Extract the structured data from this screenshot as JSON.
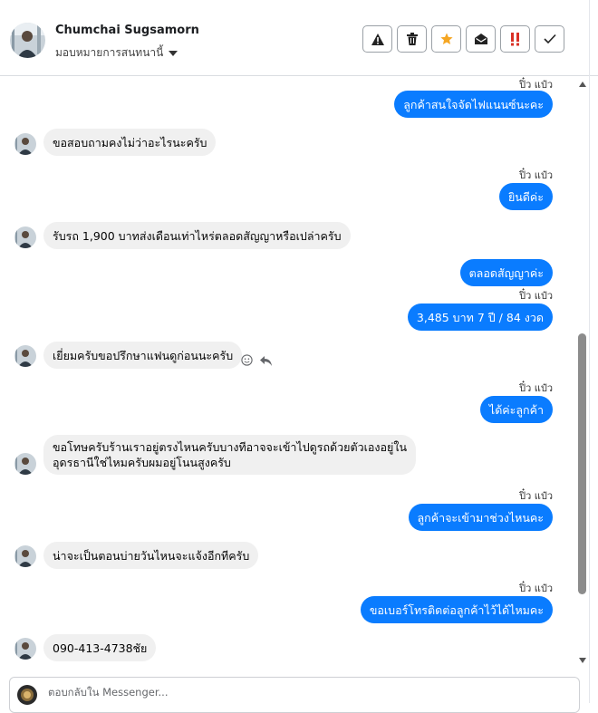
{
  "header": {
    "name": "Chumchai Sugsamorn",
    "assign_label": "มอบหมายการสนทนานี้",
    "actions": [
      {
        "name": "report-button",
        "icon": "warning-icon"
      },
      {
        "name": "delete-button",
        "icon": "trash-icon"
      },
      {
        "name": "star-button",
        "icon": "star-icon"
      },
      {
        "name": "mark-unread-button",
        "icon": "open-envelope-icon"
      },
      {
        "name": "spam-button",
        "icon": "spam-icon"
      },
      {
        "name": "done-button",
        "icon": "checkmark-icon"
      }
    ]
  },
  "messages": [
    {
      "dir": "out",
      "sender": "ปิ๋ว แป๋ว",
      "text": "ลูกค้าสนใจจัดไฟแนนซ์นะคะ"
    },
    {
      "dir": "in",
      "text": "ขอสอบถามคงไม่ว่าอะไรนะครับ"
    },
    {
      "dir": "out",
      "sender": "ปิ๋ว แป๋ว",
      "text": "ยินดีค่ะ"
    },
    {
      "dir": "in",
      "text": "รับรถ 1,900 บาทส่งเดือนเท่าไหร่ตลอดสัญญาหรือเปล่าครับ"
    },
    {
      "dir": "out",
      "text": "ตลอดสัญญาค่ะ"
    },
    {
      "dir": "out",
      "sender": "ปิ๋ว แป๋ว",
      "text": "3,485 บาท 7 ปี / 84 งวด"
    },
    {
      "dir": "in",
      "text": "เยี่ยมครับขอปรึกษาแฟนดูก่อนนะครับ"
    },
    {
      "dir": "out",
      "sender": "ปิ๋ว แป๋ว",
      "text": "ได้ค่ะลูกค้า"
    },
    {
      "dir": "in",
      "text_line1": "ขอโทษครับร้านเราอยู่ตรงไหนครับบางทีอาจจะเข้าไปดูรถด้วยตัวเองอยู่ใน",
      "text_line2": "อุดรธานีใช่ไหมครับผมอยู่โนนสูงครับ"
    },
    {
      "dir": "out",
      "sender": "ปิ๋ว แป๋ว",
      "text": "ลูกค้าจะเข้ามาช่วงไหนคะ"
    },
    {
      "dir": "in",
      "text": "น่าจะเป็นตอนบ่ายวันไหนจะแจ้งอีกทีครับ"
    },
    {
      "dir": "out",
      "sender": "ปิ๋ว แป๋ว",
      "text": "ขอเบอร์โทรติดต่อลูกค้าไว้ได้ไหมคะ"
    },
    {
      "dir": "in",
      "text": "090-413-4738ชัย"
    }
  ],
  "composer": {
    "placeholder": "ตอบกลับใน Messenger..."
  },
  "colors": {
    "outgoing_bubble": "#0a7cff",
    "incoming_bubble": "#f0f0f0",
    "star": "#f5a623",
    "spam": "#d93025"
  }
}
